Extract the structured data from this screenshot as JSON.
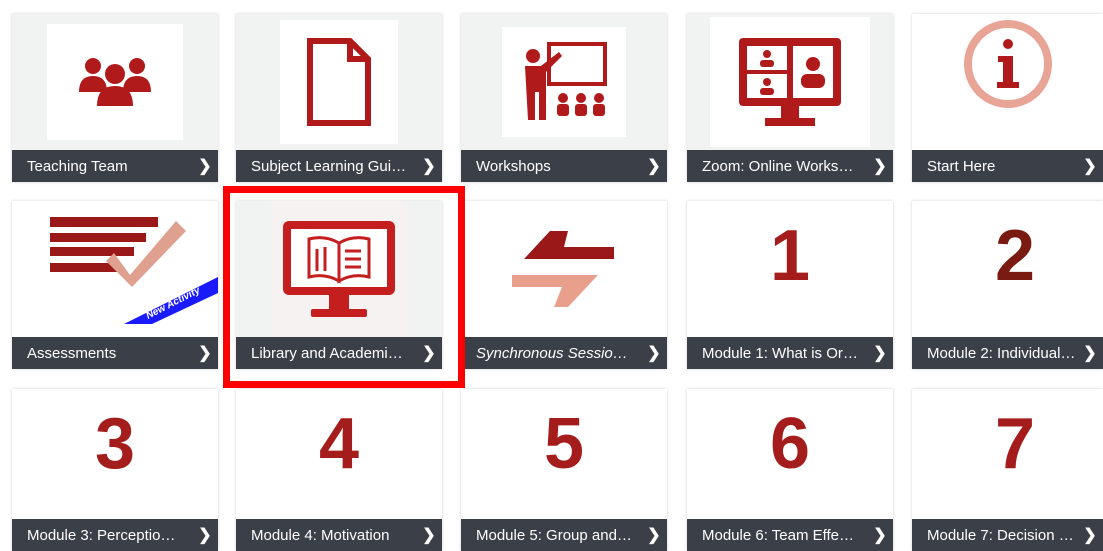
{
  "colors": {
    "accent": "#b11a1a",
    "bar": "#3b3f48",
    "highlight": "#ff0000",
    "badge": "#1a1aff"
  },
  "tiles": [
    {
      "label": "Teaching Team",
      "icon": "teaching-team-icon"
    },
    {
      "label": "Subject Learning Gui…",
      "icon": "document-icon"
    },
    {
      "label": "Workshops",
      "icon": "presentation-icon"
    },
    {
      "label": "Zoom: Online Works…",
      "icon": "video-call-icon"
    },
    {
      "label": "Start Here",
      "icon": "info-icon"
    },
    {
      "label": "Assessments",
      "icon": "assessment-checklist-icon",
      "badge": "New Activity"
    },
    {
      "label": "Library and Academi…",
      "icon": "library-monitor-icon"
    },
    {
      "label": "Synchronous Sessio…",
      "icon": "exchange-arrows-icon"
    },
    {
      "label": "Module 1: What is Or…",
      "number": "1"
    },
    {
      "label": "Module 2: Individual …",
      "number": "2"
    },
    {
      "label": "Module 3: Perceptio…",
      "number": "3"
    },
    {
      "label": "Module 4: Motivation",
      "number": "4"
    },
    {
      "label": "Module 5: Group and…",
      "number": "5"
    },
    {
      "label": "Module 6: Team Effe…",
      "number": "6"
    },
    {
      "label": "Module 7: Decision …",
      "number": "7"
    }
  ]
}
